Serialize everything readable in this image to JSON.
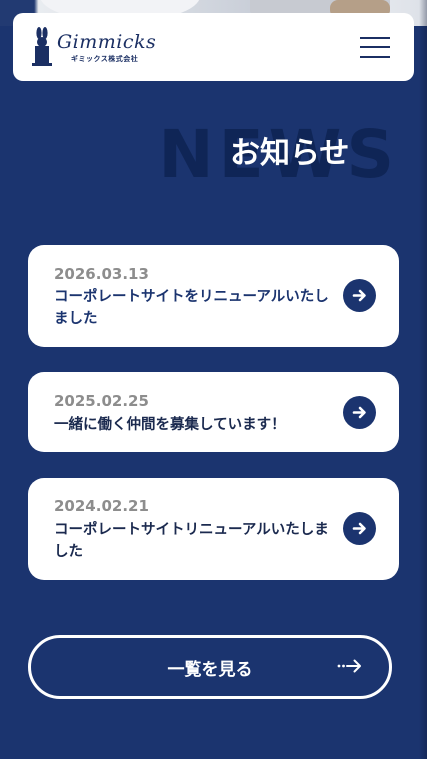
{
  "header": {
    "logo": {
      "wordmark": "Gimmicks",
      "company": "ギミックス株式会社",
      "icon": "rabbit-in-hat-icon"
    },
    "menu_icon": "hamburger-menu-icon"
  },
  "section": {
    "background_word": "NEWS",
    "title": "お知らせ"
  },
  "news": [
    {
      "date": "2026.03.13",
      "title": "コーポレートサイトをリニューアルいたしました",
      "arrow_icon": "arrow-right-circle-icon"
    },
    {
      "date": "2025.02.25",
      "title": "一緒に働く仲間を募集しています！",
      "arrow_icon": "arrow-right-circle-icon"
    },
    {
      "date": "2024.02.21",
      "title": "コーポレートサイトリニューアルいたしました",
      "arrow_icon": "arrow-right-circle-icon"
    }
  ],
  "view_all": {
    "label": "一覧を見る",
    "icon": "dotted-arrow-right-icon"
  },
  "colors": {
    "background": "#1b346f",
    "card": "#ffffff",
    "accent": "#1b346f",
    "date_gray": "#8d8d8d"
  }
}
